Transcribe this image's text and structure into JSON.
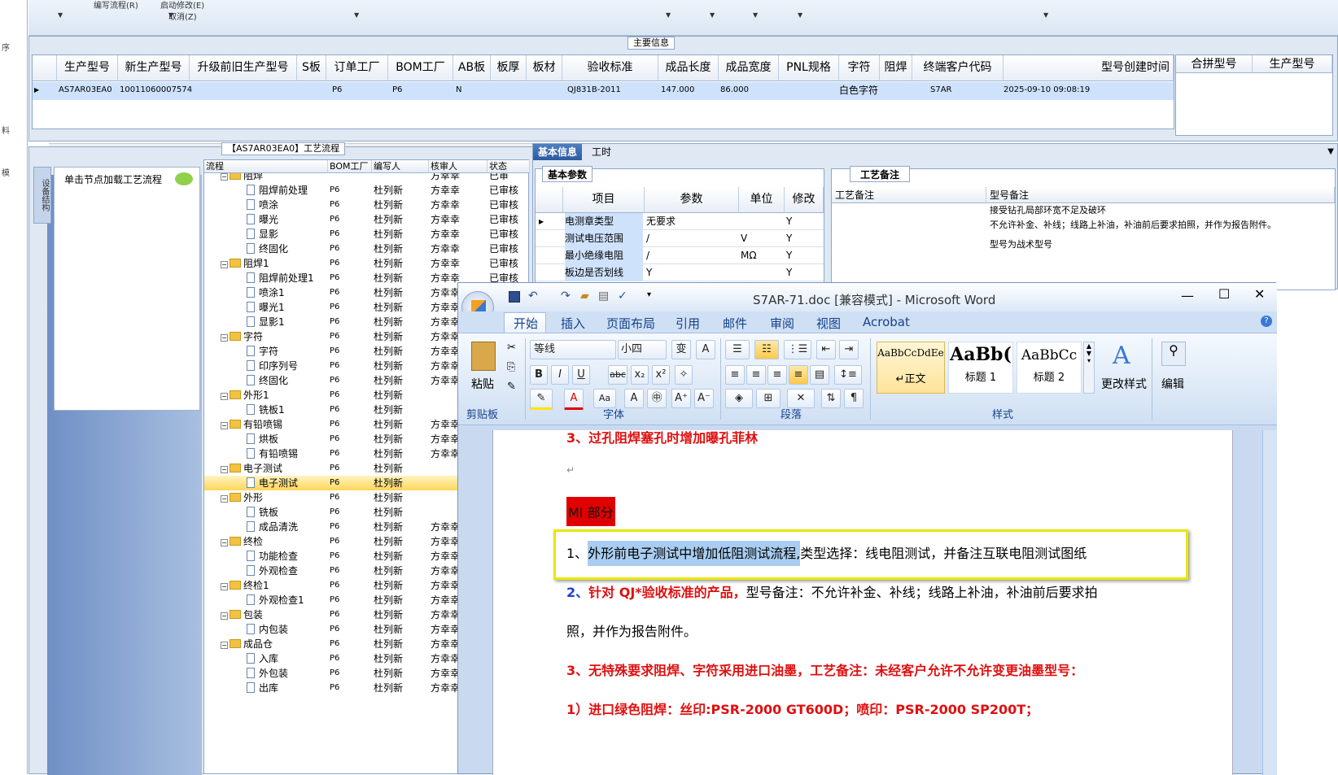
{
  "erp": {
    "left_strip_chars": [
      "序",
      "料",
      "模"
    ],
    "toolbar": {
      "item1": "编写流程(R)",
      "item2": "启动修改(E)",
      "item3": "取消(Z)"
    },
    "main_info_title": "主要信息",
    "grid_headers": [
      "生产型号",
      "新生产型号",
      "升级前旧生产型号",
      "S板",
      "订单工厂",
      "BOM工厂",
      "AB板",
      "板厚",
      "板材",
      "验收标准",
      "成品长度",
      "成品宽度",
      "PNL规格",
      "字符",
      "阻焊",
      "终端客户代码",
      "型号创建时间"
    ],
    "grid_row": [
      "AS7AR03EA0",
      "10011060007574",
      "",
      "",
      "P6",
      "P6",
      "N",
      "",
      "",
      "QJ831B-2011",
      "147.000",
      "86.000",
      "",
      "白色字符",
      "",
      "S7AR",
      "2025-09-10 09:08:19"
    ],
    "right_headers": [
      "合拼型号",
      "生产型号"
    ],
    "process_title": "【AS7AR03EA0】工艺流程",
    "side_tab": "设备结构",
    "node_hint": "单击节点加载工艺流程",
    "tree_headers": [
      "流程",
      "BOM工厂",
      "编写人",
      "核审人",
      "状态"
    ],
    "tree_rows": [
      {
        "name": "阻焊",
        "level": 0,
        "bom": "",
        "writer": "",
        "reviewer": "方幸幸",
        "status": "已审"
      },
      {
        "name": "阻焊前处理",
        "level": 1,
        "bom": "P6",
        "writer": "杜列新",
        "reviewer": "方幸幸",
        "status": "已审核"
      },
      {
        "name": "喷涂",
        "level": 1,
        "bom": "P6",
        "writer": "杜列新",
        "reviewer": "方幸幸",
        "status": "已审核"
      },
      {
        "name": "曝光",
        "level": 1,
        "bom": "P6",
        "writer": "杜列新",
        "reviewer": "方幸幸",
        "status": "已审核"
      },
      {
        "name": "显影",
        "level": 1,
        "bom": "P6",
        "writer": "杜列新",
        "reviewer": "方幸幸",
        "status": "已审核"
      },
      {
        "name": "终固化",
        "level": 1,
        "bom": "P6",
        "writer": "杜列新",
        "reviewer": "方幸幸",
        "status": "已审核"
      },
      {
        "name": "阻焊1",
        "level": 0,
        "bom": "P6",
        "writer": "杜列新",
        "reviewer": "方幸幸",
        "status": "已审核"
      },
      {
        "name": "阻焊前处理1",
        "level": 1,
        "bom": "P6",
        "writer": "杜列新",
        "reviewer": "方幸幸",
        "status": "已审核"
      },
      {
        "name": "喷涂1",
        "level": 1,
        "bom": "P6",
        "writer": "杜列新",
        "reviewer": "方幸幸",
        "status": ""
      },
      {
        "name": "曝光1",
        "level": 1,
        "bom": "P6",
        "writer": "杜列新",
        "reviewer": "方幸幸",
        "status": ""
      },
      {
        "name": "显影1",
        "level": 1,
        "bom": "P6",
        "writer": "杜列新",
        "reviewer": "方幸幸",
        "status": ""
      },
      {
        "name": "字符",
        "level": 0,
        "bom": "P6",
        "writer": "杜列新",
        "reviewer": "方幸幸",
        "status": ""
      },
      {
        "name": "字符",
        "level": 1,
        "bom": "P6",
        "writer": "杜列新",
        "reviewer": "方幸幸",
        "status": ""
      },
      {
        "name": "印序列号",
        "level": 1,
        "bom": "P6",
        "writer": "杜列新",
        "reviewer": "方幸幸",
        "status": ""
      },
      {
        "name": "终固化",
        "level": 1,
        "bom": "P6",
        "writer": "杜列新",
        "reviewer": "方幸幸",
        "status": ""
      },
      {
        "name": "外形1",
        "level": 0,
        "bom": "P6",
        "writer": "杜列新",
        "reviewer": "",
        "status": ""
      },
      {
        "name": "铣板1",
        "level": 1,
        "bom": "P6",
        "writer": "杜列新",
        "reviewer": "",
        "status": ""
      },
      {
        "name": "有铅喷锡",
        "level": 0,
        "bom": "P6",
        "writer": "杜列新",
        "reviewer": "方幸幸",
        "status": ""
      },
      {
        "name": "烘板",
        "level": 1,
        "bom": "P6",
        "writer": "杜列新",
        "reviewer": "方幸幸",
        "status": ""
      },
      {
        "name": "有铅喷锡",
        "level": 1,
        "bom": "P6",
        "writer": "杜列新",
        "reviewer": "方幸幸",
        "status": ""
      },
      {
        "name": "电子测试",
        "level": 0,
        "bom": "P6",
        "writer": "杜列新",
        "reviewer": "",
        "status": ""
      },
      {
        "name": "电子测试",
        "level": 1,
        "bom": "P6",
        "writer": "杜列新",
        "reviewer": "",
        "status": "",
        "selected": true
      },
      {
        "name": "外形",
        "level": 0,
        "bom": "P6",
        "writer": "杜列新",
        "reviewer": "",
        "status": ""
      },
      {
        "name": "铣板",
        "level": 1,
        "bom": "P6",
        "writer": "杜列新",
        "reviewer": "",
        "status": ""
      },
      {
        "name": "成品清洗",
        "level": 1,
        "bom": "P6",
        "writer": "杜列新",
        "reviewer": "方幸幸",
        "status": ""
      },
      {
        "name": "终检",
        "level": 0,
        "bom": "P6",
        "writer": "杜列新",
        "reviewer": "方幸幸",
        "status": ""
      },
      {
        "name": "功能检查",
        "level": 1,
        "bom": "P6",
        "writer": "杜列新",
        "reviewer": "方幸幸",
        "status": ""
      },
      {
        "name": "外观检查",
        "level": 1,
        "bom": "P6",
        "writer": "杜列新",
        "reviewer": "方幸幸",
        "status": ""
      },
      {
        "name": "终检1",
        "level": 0,
        "bom": "P6",
        "writer": "杜列新",
        "reviewer": "方幸幸",
        "status": ""
      },
      {
        "name": "外观检查1",
        "level": 1,
        "bom": "P6",
        "writer": "杜列新",
        "reviewer": "方幸幸",
        "status": ""
      },
      {
        "name": "包装",
        "level": 0,
        "bom": "P6",
        "writer": "杜列新",
        "reviewer": "方幸幸",
        "status": ""
      },
      {
        "name": "内包装",
        "level": 1,
        "bom": "P6",
        "writer": "杜列新",
        "reviewer": "方幸幸",
        "status": ""
      },
      {
        "name": "成品仓",
        "level": 0,
        "bom": "P6",
        "writer": "杜列新",
        "reviewer": "方幸幸",
        "status": ""
      },
      {
        "name": "入库",
        "level": 1,
        "bom": "P6",
        "writer": "杜列新",
        "reviewer": "方幸幸",
        "status": ""
      },
      {
        "name": "外包装",
        "level": 1,
        "bom": "P6",
        "writer": "杜列新",
        "reviewer": "方幸幸",
        "status": ""
      },
      {
        "name": "出库",
        "level": 1,
        "bom": "P6",
        "writer": "杜列新",
        "reviewer": "方幸幸",
        "status": ""
      }
    ],
    "info_tabs": [
      "基本信息",
      "工时"
    ],
    "basic_params_tab": "基本参数",
    "params_headers": [
      "项目",
      "参数",
      "单位",
      "修改"
    ],
    "params_rows": [
      [
        "电测章类型",
        "无要求",
        "",
        "Y"
      ],
      [
        "测试电压范围",
        "/",
        "V",
        "Y"
      ],
      [
        "最小绝缘电阻",
        "/",
        "MΩ",
        "Y"
      ],
      [
        "板边是否划线",
        "Y",
        "",
        "Y"
      ]
    ],
    "remarks_tab": "工艺备注",
    "remarks_headers": [
      "工艺备注",
      "型号备注"
    ],
    "model_remarks": [
      "接受钻孔局部环宽不足及破环",
      "不允许补金、补线；线路上补油，补油前后要求拍照，并作为报告附件。",
      "型号为战术型号"
    ]
  },
  "word": {
    "title": "S7AR-71.doc [兼容模式] - Microsoft Word",
    "tabs": [
      "开始",
      "插入",
      "页面布局",
      "引用",
      "邮件",
      "审阅",
      "视图",
      "Acrobat"
    ],
    "clipboard": {
      "paste": "粘贴",
      "label": "剪贴板"
    },
    "font": {
      "name": "等线",
      "size": "小四",
      "label": "字体"
    },
    "paragraph_label": "段落",
    "styles": [
      {
        "preview": "AaBbCcDdEe",
        "name": "↵正文"
      },
      {
        "preview": "AaBb(",
        "name": "标题 1"
      },
      {
        "preview": "AaBbCc",
        "name": "标题 2"
      }
    ],
    "styles_label": "样式",
    "change_styles": "更改样式",
    "edit": "编辑",
    "doc": {
      "line1": "3、过孔阻焊塞孔时增加曝孔菲林",
      "mi": "MI 部分",
      "item1_hl": "外形前电子测试中增加低阻测试流程,",
      "item1_num": "1、",
      "item1_rest": "类型选择：线电阻测试，并备注互联电阻测试图纸",
      "item2_num": "2、",
      "item2_red": "针对 QJ*验收标准的产品，",
      "item2_rest": "型号备注：不允许补金、补线；线路上补油，补油前后要求拍",
      "item2_cont": "照，并作为报告附件。",
      "item3": "3、无特殊要求阻焊、字符采用进口油墨，工艺备注：未经客户允许不允许变更油墨型号：",
      "item4": "1）进口绿色阻焊：丝印:PSR-2000 GT600D；喷印：PSR-2000 SP200T；"
    }
  }
}
